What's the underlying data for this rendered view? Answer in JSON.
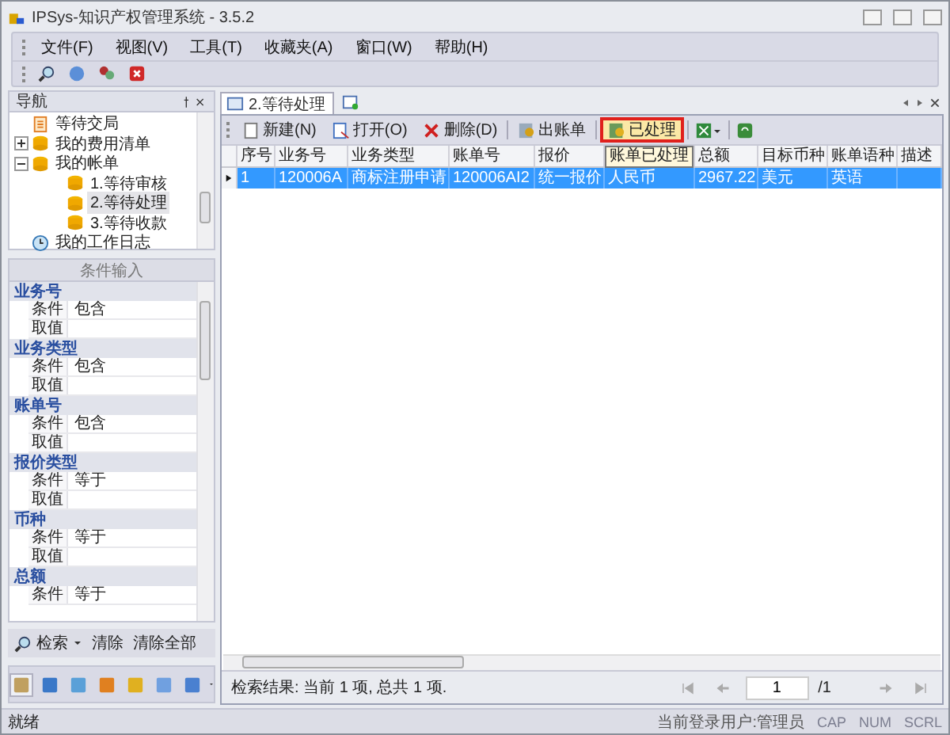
{
  "window": {
    "title": "IPSys-知识产权管理系统 - 3.5.2"
  },
  "menu": [
    "文件(F)",
    "视图(V)",
    "工具(T)",
    "收藏夹(A)",
    "窗口(W)",
    "帮助(H)"
  ],
  "navigation": {
    "title": "导航",
    "tree": [
      {
        "label": "等待交局",
        "kind": "doc",
        "selected": false
      },
      {
        "label": "我的费用清单",
        "kind": "db",
        "selected": false,
        "expanded": false
      },
      {
        "label": "我的帐单",
        "kind": "db",
        "selected": false,
        "expanded": true,
        "children": [
          {
            "label": "1.等待审核",
            "kind": "db",
            "selected": false
          },
          {
            "label": "2.等待处理",
            "kind": "db",
            "selected": true
          },
          {
            "label": "3.等待收款",
            "kind": "db",
            "selected": false
          }
        ]
      },
      {
        "label": "我的工作日志",
        "kind": "log",
        "selected": false
      }
    ]
  },
  "conditions": {
    "title": "条件输入",
    "groups": [
      {
        "name": "业务号",
        "rows": [
          {
            "label": "条件",
            "value": "包含"
          },
          {
            "label": "取值"
          }
        ]
      },
      {
        "name": "业务类型",
        "rows": [
          {
            "label": "条件",
            "value": "包含"
          },
          {
            "label": "取值"
          }
        ]
      },
      {
        "name": "账单号",
        "rows": [
          {
            "label": "条件",
            "value": "包含"
          },
          {
            "label": "取值"
          }
        ]
      },
      {
        "name": "报价类型",
        "rows": [
          {
            "label": "条件",
            "value": "等于"
          },
          {
            "label": "取值"
          }
        ]
      },
      {
        "name": "币种",
        "rows": [
          {
            "label": "条件",
            "value": "等于"
          },
          {
            "label": "取值"
          }
        ]
      },
      {
        "name": "总额",
        "rows": [
          {
            "label": "条件",
            "value": "等于"
          }
        ]
      }
    ]
  },
  "search_actions": [
    {
      "label": "检索",
      "kind": "search"
    },
    {
      "label": "清除",
      "kind": "plain"
    },
    {
      "label": "清除全部",
      "kind": "plain"
    }
  ],
  "document_tabs": [
    {
      "label": "2.等待处理",
      "selected": true
    }
  ],
  "grid_toolbar": {
    "buttons": [
      {
        "label": "新建(N)",
        "kind": "new",
        "highlighted": false
      },
      {
        "label": "打开(O)",
        "kind": "open",
        "highlighted": false
      },
      {
        "label": "删除(D)",
        "kind": "delete",
        "highlighted": false
      },
      {
        "label": "出账单",
        "kind": "bill",
        "highlighted": false
      },
      {
        "label": "已处理",
        "kind": "done",
        "highlighted": true
      }
    ],
    "tooltip": "账单已处理"
  },
  "grid": {
    "columns": [
      {
        "label": "序号"
      },
      {
        "label": "业务号"
      },
      {
        "label": "业务类型"
      },
      {
        "label": "账单号"
      },
      {
        "label": "报价"
      },
      {},
      {
        "label": "总额"
      },
      {
        "label": "目标币种"
      },
      {
        "label": "账单语种"
      },
      {
        "label": "描述"
      }
    ],
    "rows": [
      {
        "selected": true,
        "cells": [
          "1",
          "120006A",
          "商标注册申请",
          "120006AI2",
          "统一报价",
          "人民币",
          "2967.22",
          "美元",
          "英语"
        ]
      }
    ]
  },
  "result_text": "检索结果: 当前 1 项, 总共 1 项.",
  "pager": {
    "page": "1",
    "total": "/1"
  },
  "status_bar": {
    "message": "就绪",
    "user": "当前登录用户:管理员",
    "indicators": [
      {
        "label": "CAP",
        "on": false
      },
      {
        "label": "NUM",
        "on": false
      },
      {
        "label": "SCRL",
        "on": false
      }
    ]
  }
}
